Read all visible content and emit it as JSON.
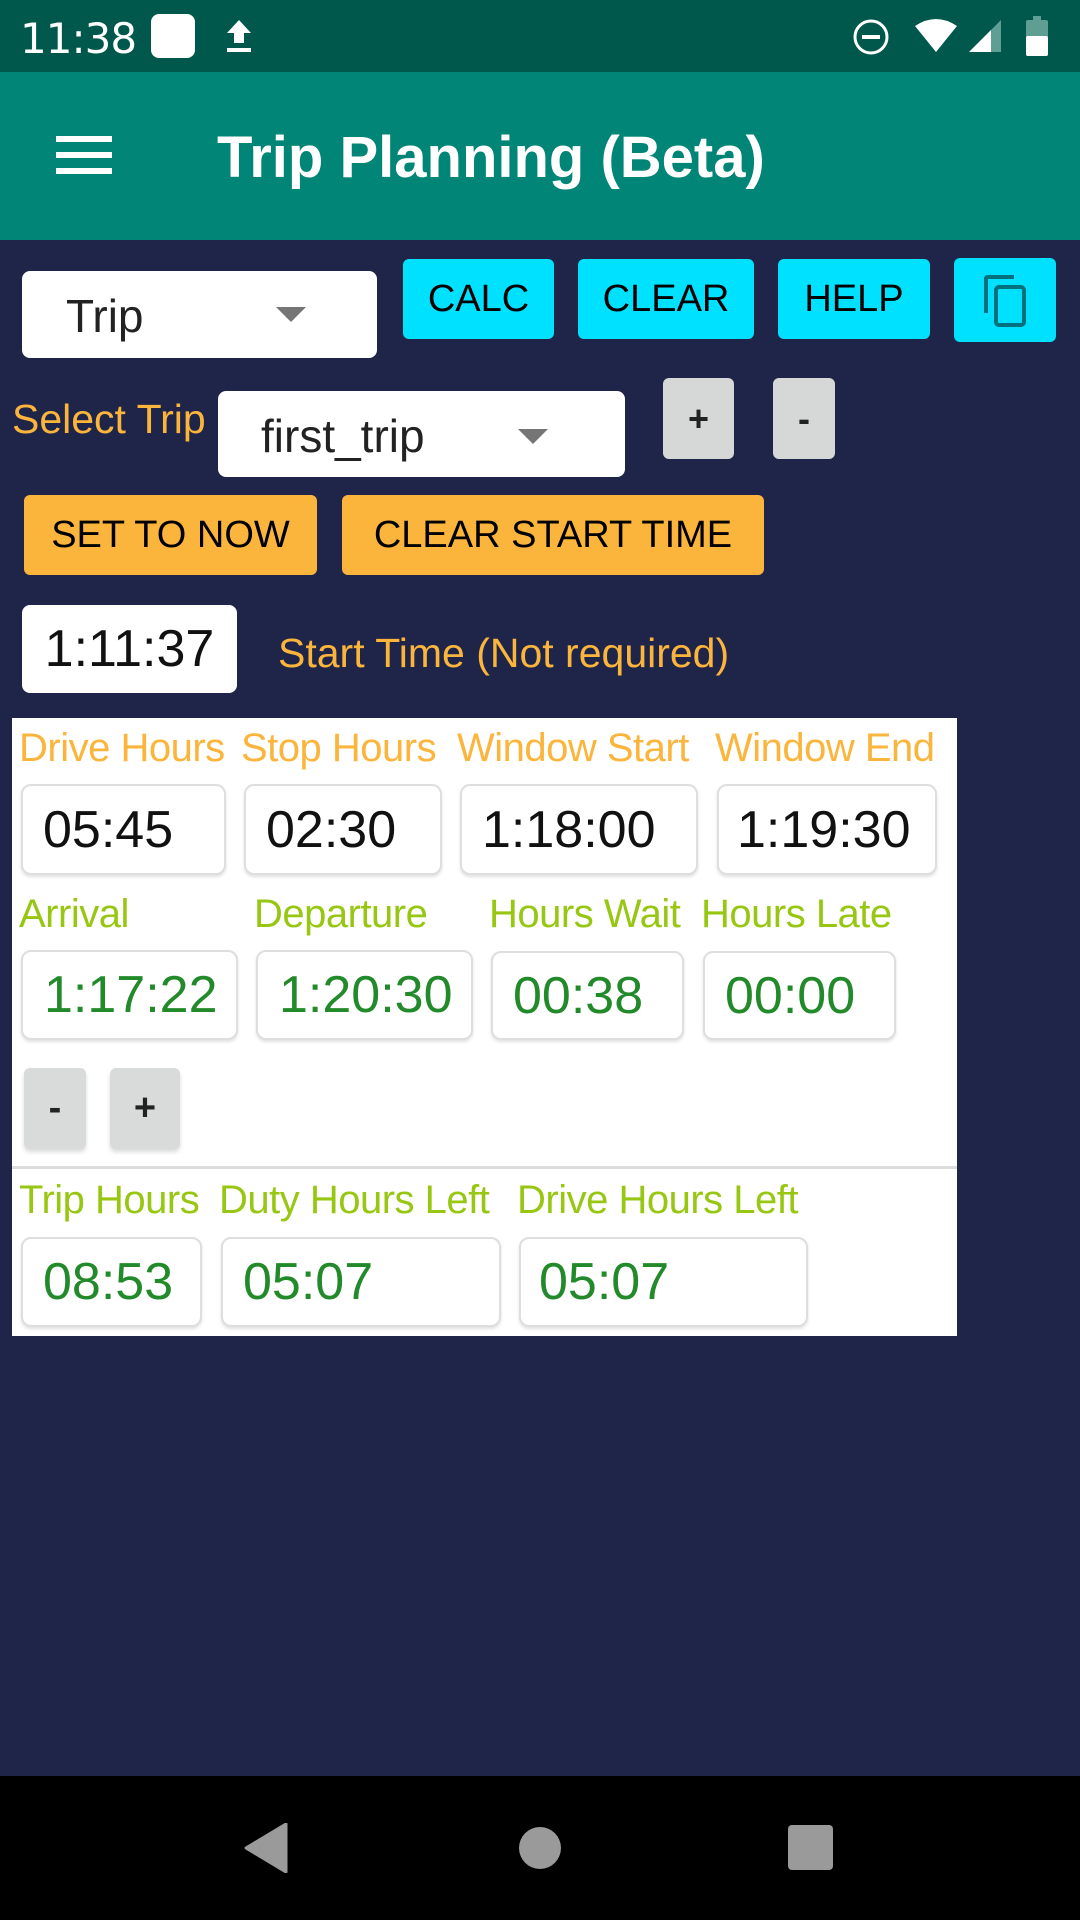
{
  "status_bar": {
    "time": "11:38",
    "icons": [
      "notification-square-icon",
      "upload-icon",
      "do-not-disturb-icon",
      "wifi-icon",
      "cell-signal-icon",
      "battery-icon"
    ]
  },
  "app_bar": {
    "title": "Trip Planning (Beta)",
    "menu_icon": "hamburger-menu-icon"
  },
  "toolbar": {
    "mode_dropdown_value": "Trip",
    "calc_label": "CALC",
    "clear_label": "CLEAR",
    "help_label": "HELP",
    "copy_icon": "copy-icon"
  },
  "trip_select": {
    "label": "Select Trip",
    "value": "first_trip",
    "add_label": "+",
    "remove_label": "-"
  },
  "start_controls": {
    "set_now_label": "SET TO NOW",
    "clear_start_label": "CLEAR START TIME",
    "start_time_value": "1:11:37",
    "start_time_label": "Start Time (Not required)"
  },
  "inputs": {
    "drive_hours": {
      "label": "Drive Hours",
      "value": "05:45"
    },
    "stop_hours": {
      "label": "Stop Hours",
      "value": "02:30"
    },
    "window_start": {
      "label": "Window Start",
      "value": "1:18:00"
    },
    "window_end": {
      "label": "Window End",
      "value": "1:19:30"
    }
  },
  "results": {
    "arrival": {
      "label": "Arrival",
      "value": "1:17:22"
    },
    "departure": {
      "label": "Departure",
      "value": "1:20:30"
    },
    "hours_wait": {
      "label": "Hours Wait",
      "value": "00:38"
    },
    "hours_late": {
      "label": "Hours Late",
      "value": "00:00"
    }
  },
  "stop_controls": {
    "decrement_label": "-",
    "increment_label": "+"
  },
  "summary": {
    "trip_hours": {
      "label": "Trip Hours",
      "value": "08:53"
    },
    "duty_hours_left": {
      "label": "Duty Hours Left",
      "value": "05:07"
    },
    "drive_hours_left": {
      "label": "Drive Hours Left",
      "value": "05:07"
    }
  },
  "colors": {
    "status_bar": "#00574b",
    "app_bar": "#008577",
    "background": "#1f2548",
    "cyan_button": "#00e1ff",
    "orange_accent": "#fbb53c",
    "lime_label": "#97c712",
    "result_green": "#228a2a"
  }
}
